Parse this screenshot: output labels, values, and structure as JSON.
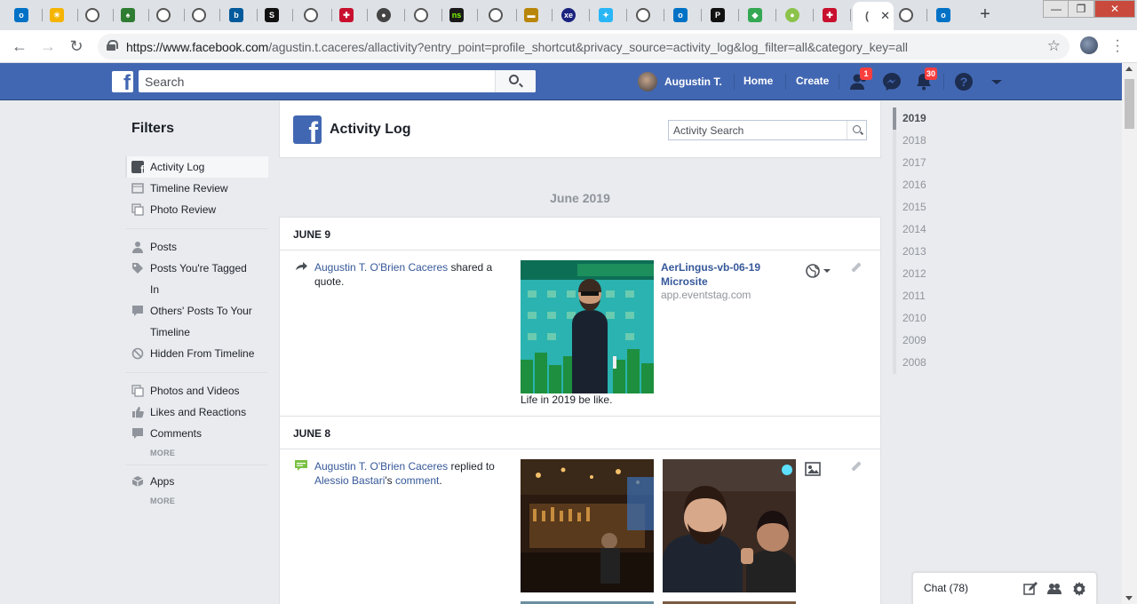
{
  "browser": {
    "url_host": "https://www.facebook.com",
    "url_path": "/agustin.t.caceres/allactivity?entry_point=profile_shortcut&privacy_source=activity_log&log_filter=all&category_key=all",
    "new_tab_label": "+",
    "window": {
      "minimize": "—",
      "maximize": "❐",
      "close": "✕"
    }
  },
  "fb_header": {
    "logo": "f",
    "search_placeholder": "Search",
    "user_name": "Augustin T.",
    "home": "Home",
    "create": "Create",
    "friend_requests_count": "1",
    "notifications_count": "30"
  },
  "filters": {
    "title": "Filters",
    "group1": [
      {
        "label": "Activity Log"
      },
      {
        "label": "Timeline Review"
      },
      {
        "label": "Photo Review"
      }
    ],
    "group2": [
      {
        "label": "Posts"
      },
      {
        "label": "Posts You're Tagged In"
      },
      {
        "label": "Others' Posts To Your Timeline"
      },
      {
        "label": "Hidden From Timeline"
      }
    ],
    "group3": [
      {
        "label": "Photos and Videos"
      },
      {
        "label": "Likes and Reactions"
      },
      {
        "label": "Comments"
      }
    ],
    "more_label": "MORE",
    "group4": [
      {
        "label": "Apps"
      }
    ]
  },
  "activity_log": {
    "title": "Activity Log",
    "search_placeholder": "Activity Search",
    "month": "June 2019",
    "days": [
      {
        "header": "JUNE 9",
        "actor": "Augustin T. O'Brien Caceres",
        "action": " shared a quote.",
        "link_title": "AerLingus-vb-06-19 Microsite",
        "link_domain": "app.eventstag.com",
        "caption": "Life in 2019 be like."
      },
      {
        "header": "JUNE 8",
        "actor": "Augustin T. O'Brien Caceres",
        "action": " replied to ",
        "target": "Alessio Bastari",
        "target_suffix": "'s ",
        "object": "comment",
        "end": "."
      }
    ]
  },
  "years": [
    "2019",
    "2018",
    "2017",
    "2016",
    "2015",
    "2014",
    "2013",
    "2012",
    "2011",
    "2010",
    "2009",
    "2008"
  ],
  "chat": {
    "label": "Chat (78)"
  },
  "colors": {
    "fb_blue": "#4267b2",
    "link": "#365899",
    "badge": "#fa3e3e"
  }
}
